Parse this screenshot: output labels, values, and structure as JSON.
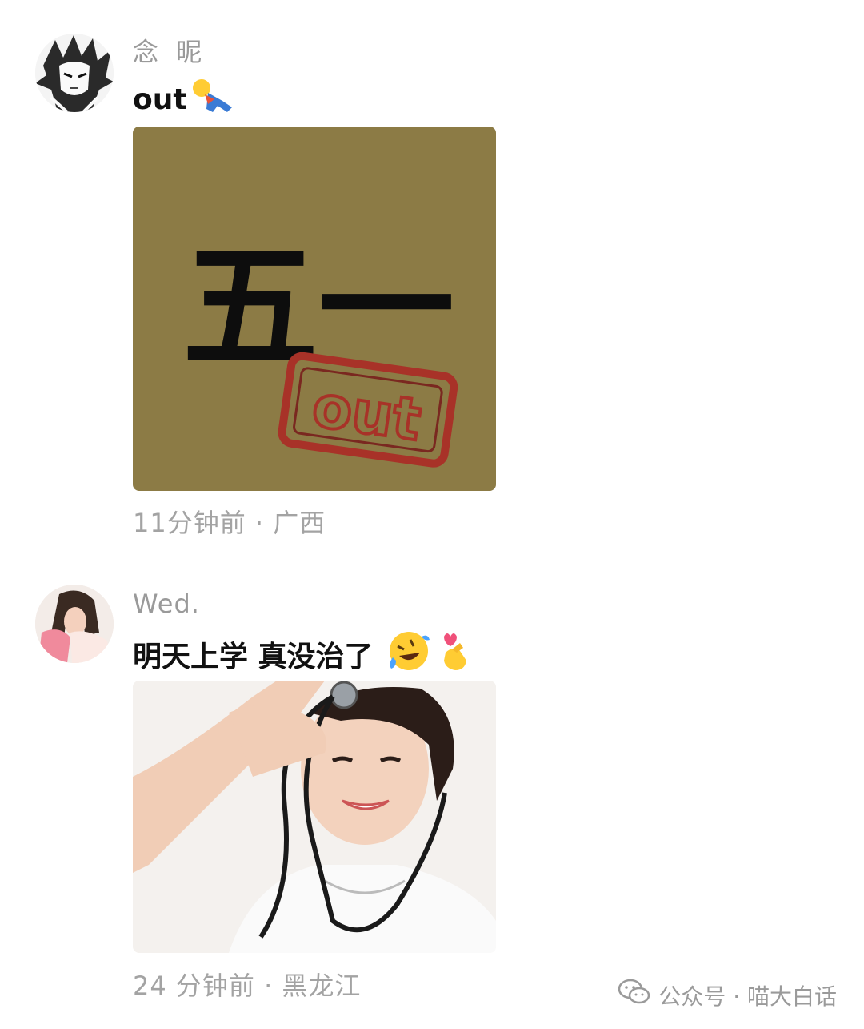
{
  "posts": [
    {
      "username": "念 昵",
      "text": "out",
      "emojis": [
        "falling-person-emoji"
      ],
      "image": {
        "kind": "meme",
        "big_text": "五一",
        "stamp_text": "out",
        "background": "#8c7b45",
        "stamp_color": "#a83228"
      },
      "meta": "11分钟前 · 广西"
    },
    {
      "username": "Wed.",
      "text": "明天上学 真没治了",
      "emojis": [
        "rolling-laughing-emoji",
        "finger-heart-emoji"
      ],
      "image": {
        "kind": "photo-nurse-stethoscope"
      },
      "meta": "24 分钟前 · 黑龙江"
    }
  ],
  "watermark": {
    "icon": "wechat-icon",
    "text": "公众号 · 喵大白话"
  }
}
